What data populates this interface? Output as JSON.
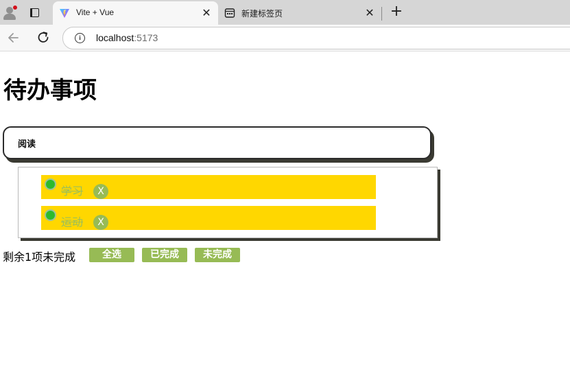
{
  "browser": {
    "tabs": [
      {
        "title": "Vite + Vue",
        "active": true,
        "icon": "vite-logo-icon"
      },
      {
        "title": "新建标签页",
        "active": false,
        "icon": "new-tab-page-icon"
      }
    ],
    "close_glyph": "✕",
    "new_tab_glyph": "+",
    "url_host": "localhost",
    "url_port": ":5173"
  },
  "app": {
    "title": "待办事项",
    "input_value": "阅读",
    "todos": [
      {
        "text": "学习",
        "completed": true,
        "delete_label": "X"
      },
      {
        "text": "运动",
        "completed": true,
        "delete_label": "X"
      }
    ],
    "footer": {
      "remaining_text": "剩余1项未完成",
      "select_all_label": "全选",
      "completed_label": "已完成",
      "uncompleted_label": "未完成"
    }
  },
  "colors": {
    "item_background": "#ffd700",
    "button_green": "#97bb55",
    "toggle_green": "#2dba2d"
  }
}
